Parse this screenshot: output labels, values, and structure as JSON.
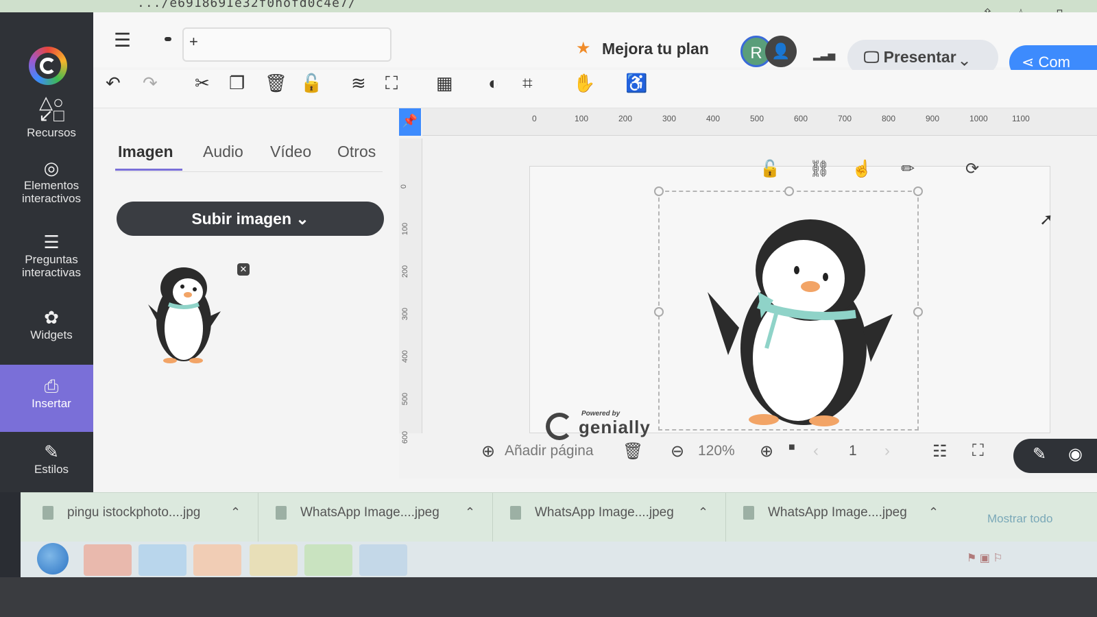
{
  "browser": {
    "url_fragment": ".../e691869Ie32f0hofd0c4e7/",
    "icons": [
      "share-icon",
      "star-icon",
      "panel-icon"
    ]
  },
  "sidebar": {
    "items": [
      {
        "label": "Recursos",
        "icon": "resources-icon"
      },
      {
        "label": "Elementos interactivos",
        "icon": "interactive-elements-icon"
      },
      {
        "label": "Preguntas interactivas",
        "icon": "questions-icon"
      },
      {
        "label": "Widgets",
        "icon": "widgets-icon"
      },
      {
        "label": "Insertar",
        "icon": "insert-icon",
        "active": true
      },
      {
        "label": "Estilos",
        "icon": "styles-icon"
      }
    ]
  },
  "header": {
    "title_placeholder": "+",
    "upgrade_label": "Mejora tu plan",
    "avatar_initial": "R",
    "present_label": "Presentar",
    "share_label": "Com"
  },
  "panel": {
    "tabs": [
      "Imagen",
      "Audio",
      "Vídeo",
      "Otros"
    ],
    "active_tab": "Imagen",
    "upload_label": "Subir imagen"
  },
  "canvas": {
    "ruler_h": [
      "0",
      "100",
      "200",
      "300",
      "400",
      "500",
      "600",
      "700",
      "800",
      "900",
      "1000",
      "1100"
    ],
    "ruler_v": [
      "0",
      "100",
      "200",
      "300",
      "400",
      "500",
      "600"
    ],
    "powered_small": "Powered by",
    "powered_brand": "genially"
  },
  "bottom_bar": {
    "add_page_label": "Añadir página",
    "zoom": "120%",
    "page_number": "1"
  },
  "downloads": {
    "files": [
      "pingu istockphoto....jpg",
      "WhatsApp Image....jpeg",
      "WhatsApp Image....jpeg",
      "WhatsApp Image....jpeg"
    ],
    "show_all": "Mostrar todo"
  },
  "colors": {
    "accent": "#7a6fd8",
    "primary_blue": "#3d8bfd",
    "sidebar_bg": "#2f3237",
    "ribbon": "#8fd3c8"
  }
}
